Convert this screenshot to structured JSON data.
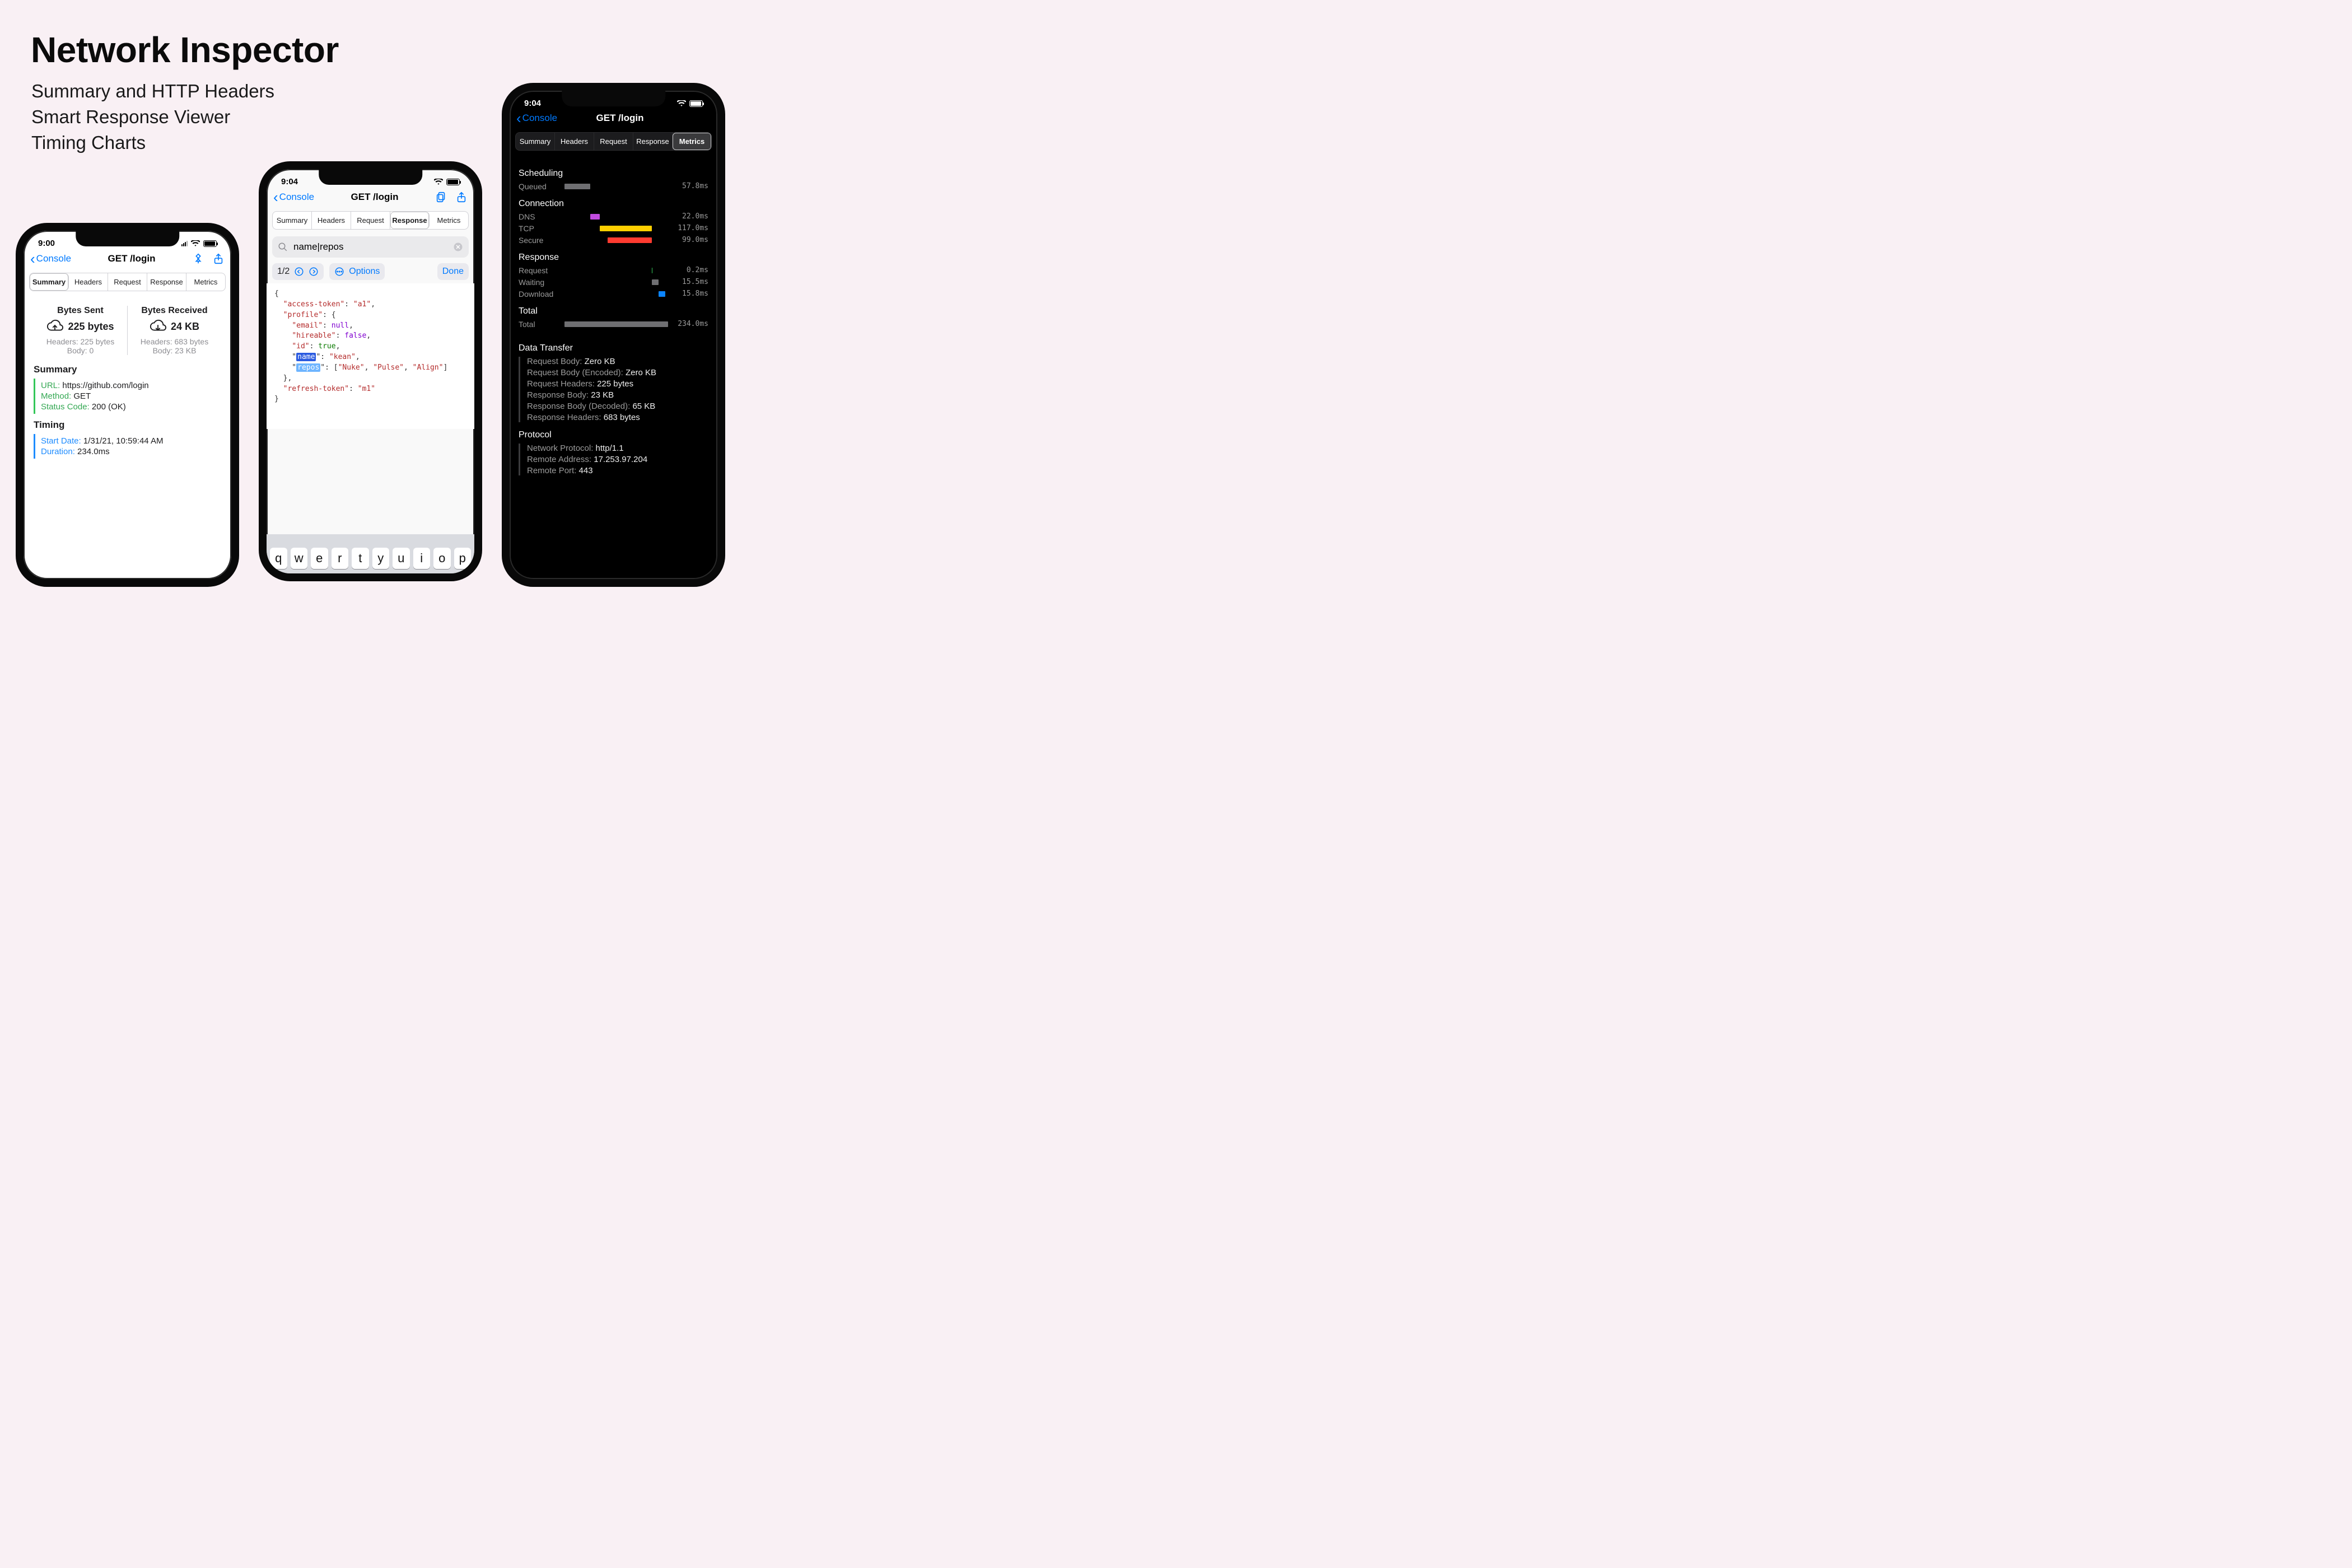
{
  "promo": {
    "title": "Network Inspector",
    "lines": [
      "Summary and HTTP Headers",
      "Smart Response Viewer",
      "Timing Charts"
    ]
  },
  "phone1": {
    "time": "9:00",
    "back": "Console",
    "title": "GET /login",
    "tabs": [
      "Summary",
      "Headers",
      "Request",
      "Response",
      "Metrics"
    ],
    "active_tab": 0,
    "bytes_sent": {
      "title": "Bytes Sent",
      "total": "225 bytes",
      "headers": "Headers: 225 bytes",
      "body": "Body: 0"
    },
    "bytes_recv": {
      "title": "Bytes Received",
      "total": "24 KB",
      "headers": "Headers: 683 bytes",
      "body": "Body: 23 KB"
    },
    "summary_title": "Summary",
    "summary": {
      "url_k": "URL:",
      "url_v": "https://github.com/login",
      "method_k": "Method:",
      "method_v": "GET",
      "status_k": "Status Code:",
      "status_v": "200 (OK)"
    },
    "timing_title": "Timing",
    "timing": {
      "start_k": "Start Date:",
      "start_v": "1/31/21, 10:59:44 AM",
      "dur_k": "Duration:",
      "dur_v": "234.0ms"
    }
  },
  "phone2": {
    "time": "9:04",
    "back": "Console",
    "title": "GET /login",
    "tabs": [
      "Summary",
      "Headers",
      "Request",
      "Response",
      "Metrics"
    ],
    "active_tab": 3,
    "search": {
      "placeholder": "",
      "value": "name|repos"
    },
    "counter": "1/2",
    "options": "Options",
    "done": "Done",
    "json": {
      "l0": "{",
      "l1_k": "\"access-token\"",
      "l1_v": "\"a1\"",
      "l2_k": "\"profile\"",
      "l3_k": "\"email\"",
      "l3_v": "null",
      "l4_k": "\"hireable\"",
      "l4_v": "false",
      "l5_k": "\"id\"",
      "l5_v": "true",
      "l6_k": "name",
      "l6_v": "\"kean\"",
      "l7_k": "repos",
      "l7_a": "\"Nuke\"",
      "l7_b": "\"Pulse\"",
      "l7_c": "\"Align\"",
      "l8_k": "\"refresh-token\"",
      "l8_v": "\"m1\""
    },
    "keys": [
      "q",
      "w",
      "e",
      "r",
      "t",
      "y",
      "u",
      "i",
      "o",
      "p"
    ]
  },
  "phone3": {
    "time": "9:04",
    "back": "Console",
    "title": "GET /login",
    "tabs": [
      "Summary",
      "Headers",
      "Request",
      "Response",
      "Metrics"
    ],
    "active_tab": 4,
    "sections": {
      "scheduling": "Scheduling",
      "connection": "Connection",
      "response": "Response",
      "total": "Total",
      "data": "Data Transfer",
      "proto": "Protocol"
    },
    "rows": {
      "queued": {
        "label": "Queued",
        "val": "57.8ms"
      },
      "dns": {
        "label": "DNS",
        "val": "22.0ms"
      },
      "tcp": {
        "label": "TCP",
        "val": "117.0ms"
      },
      "secure": {
        "label": "Secure",
        "val": "99.0ms"
      },
      "req": {
        "label": "Request",
        "val": "0.2ms"
      },
      "wait": {
        "label": "Waiting",
        "val": "15.5ms"
      },
      "dl": {
        "label": "Download",
        "val": "15.8ms"
      },
      "total": {
        "label": "Total",
        "val": "234.0ms"
      }
    },
    "data_transfer": [
      {
        "k": "Request Body:",
        "v": "Zero KB"
      },
      {
        "k": "Request Body (Encoded):",
        "v": "Zero KB"
      },
      {
        "k": "Request Headers:",
        "v": "225 bytes"
      },
      {
        "k": "Response Body:",
        "v": "23 KB"
      },
      {
        "k": "Response Body (Decoded):",
        "v": "65 KB"
      },
      {
        "k": "Response Headers:",
        "v": "683 bytes"
      }
    ],
    "protocol": [
      {
        "k": "Network Protocol:",
        "v": "http/1.1"
      },
      {
        "k": "Remote Address:",
        "v": "17.253.97.204"
      },
      {
        "k": "Remote Port:",
        "v": "443"
      }
    ]
  },
  "chart_data": {
    "type": "bar",
    "title": "Request Timing",
    "xlabel": "ms",
    "ylabel": "",
    "total_ms": 234.0,
    "series": [
      {
        "group": "Scheduling",
        "name": "Queued",
        "start": 0,
        "duration": 57.8,
        "color": "#6f6f72"
      },
      {
        "group": "Connection",
        "name": "DNS",
        "start": 57.8,
        "duration": 22.0,
        "color": "#c24be0"
      },
      {
        "group": "Connection",
        "name": "TCP",
        "start": 79.8,
        "duration": 117.0,
        "color": "#ffcf00"
      },
      {
        "group": "Connection",
        "name": "Secure",
        "start": 97.8,
        "duration": 99.0,
        "color": "#ff3b30"
      },
      {
        "group": "Response",
        "name": "Request",
        "start": 196.8,
        "duration": 0.2,
        "color": "#34c759"
      },
      {
        "group": "Response",
        "name": "Waiting",
        "start": 197.0,
        "duration": 15.5,
        "color": "#6f6f72"
      },
      {
        "group": "Response",
        "name": "Download",
        "start": 212.5,
        "duration": 15.8,
        "color": "#0b84ff"
      },
      {
        "group": "Total",
        "name": "Total",
        "start": 0,
        "duration": 234.0,
        "color": "#6f6f72"
      }
    ]
  }
}
